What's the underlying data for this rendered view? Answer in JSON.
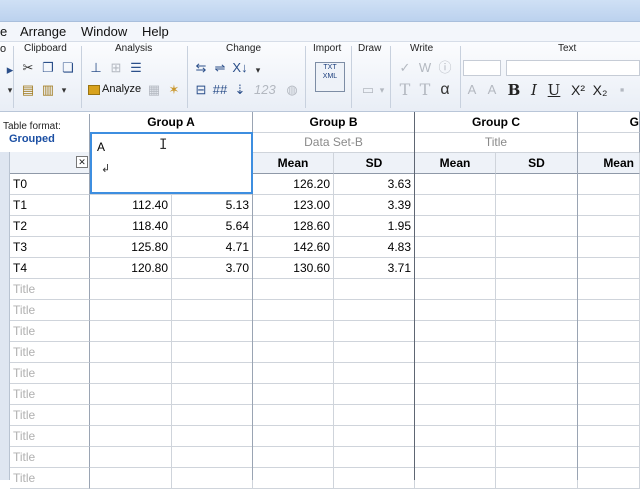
{
  "menu": [
    "e",
    "Arrange",
    "Window",
    "Help"
  ],
  "ribbon_groups": [
    "Clipboard",
    "Analysis",
    "Change",
    "Import",
    "Draw",
    "Write",
    "Text"
  ],
  "ribbon": {
    "analyze_label": "Analyze",
    "left_cut": "o",
    "import_icon_text": "TXT\nXML"
  },
  "table_format": {
    "label": "Table format:",
    "value": "Grouped"
  },
  "editor": {
    "value": "A",
    "enter_glyph": "↲"
  },
  "groups": [
    {
      "name": "Group A",
      "dataset": "",
      "cols": [
        "",
        ""
      ]
    },
    {
      "name": "Group B",
      "dataset": "Data Set-B",
      "cols": [
        "Mean",
        "SD"
      ]
    },
    {
      "name": "Group C",
      "dataset": "Title",
      "cols": [
        "Mean",
        "SD"
      ]
    },
    {
      "name": "G",
      "dataset": "",
      "cols": [
        "Mean",
        ""
      ]
    }
  ],
  "rows": [
    {
      "label": "T0",
      "values": [
        "",
        "",
        "126.20",
        "3.63",
        "",
        "",
        "",
        ""
      ]
    },
    {
      "label": "T1",
      "values": [
        "112.40",
        "5.13",
        "123.00",
        "3.39",
        "",
        "",
        "",
        ""
      ]
    },
    {
      "label": "T2",
      "values": [
        "118.40",
        "5.64",
        "128.60",
        "1.95",
        "",
        "",
        "",
        ""
      ]
    },
    {
      "label": "T3",
      "values": [
        "125.80",
        "4.71",
        "142.60",
        "4.83",
        "",
        "",
        "",
        ""
      ]
    },
    {
      "label": "T4",
      "values": [
        "120.80",
        "3.70",
        "130.60",
        "3.71",
        "",
        "",
        "",
        ""
      ]
    }
  ],
  "placeholder_rows": [
    "Title",
    "Title",
    "Title",
    "Title",
    "Title",
    "Title",
    "Title",
    "Title",
    "Title",
    "Title"
  ],
  "colors": {
    "accent": "#3d8ee0",
    "table_format_value": "#1b4fa3",
    "header_bg": "#eef2f8"
  }
}
